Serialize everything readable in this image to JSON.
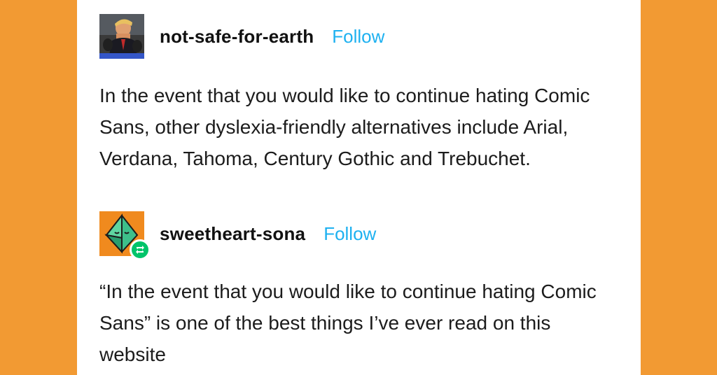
{
  "posts": [
    {
      "username": "not-safe-for-earth",
      "follow_label": "Follow",
      "body": "In the event that you would like to continue hating Comic Sans, other dyslexia-friendly alternatives include Arial, Verdana, Tahoma, Century Gothic and Trebuchet.",
      "avatar_icon": "profile-photo-avatar"
    },
    {
      "username": "sweetheart-sona",
      "follow_label": "Follow",
      "body": "“In the event that you would like to continue hating Comic Sans” is one of the best things I’ve ever read on this website",
      "avatar_icon": "crystal-character-avatar",
      "badge_icon": "reblog-icon"
    }
  ],
  "colors": {
    "background": "#f29a33",
    "card": "#ffffff",
    "follow": "#1eb1f0",
    "reblog_badge": "#00c46a",
    "text": "#1c1c1c"
  }
}
